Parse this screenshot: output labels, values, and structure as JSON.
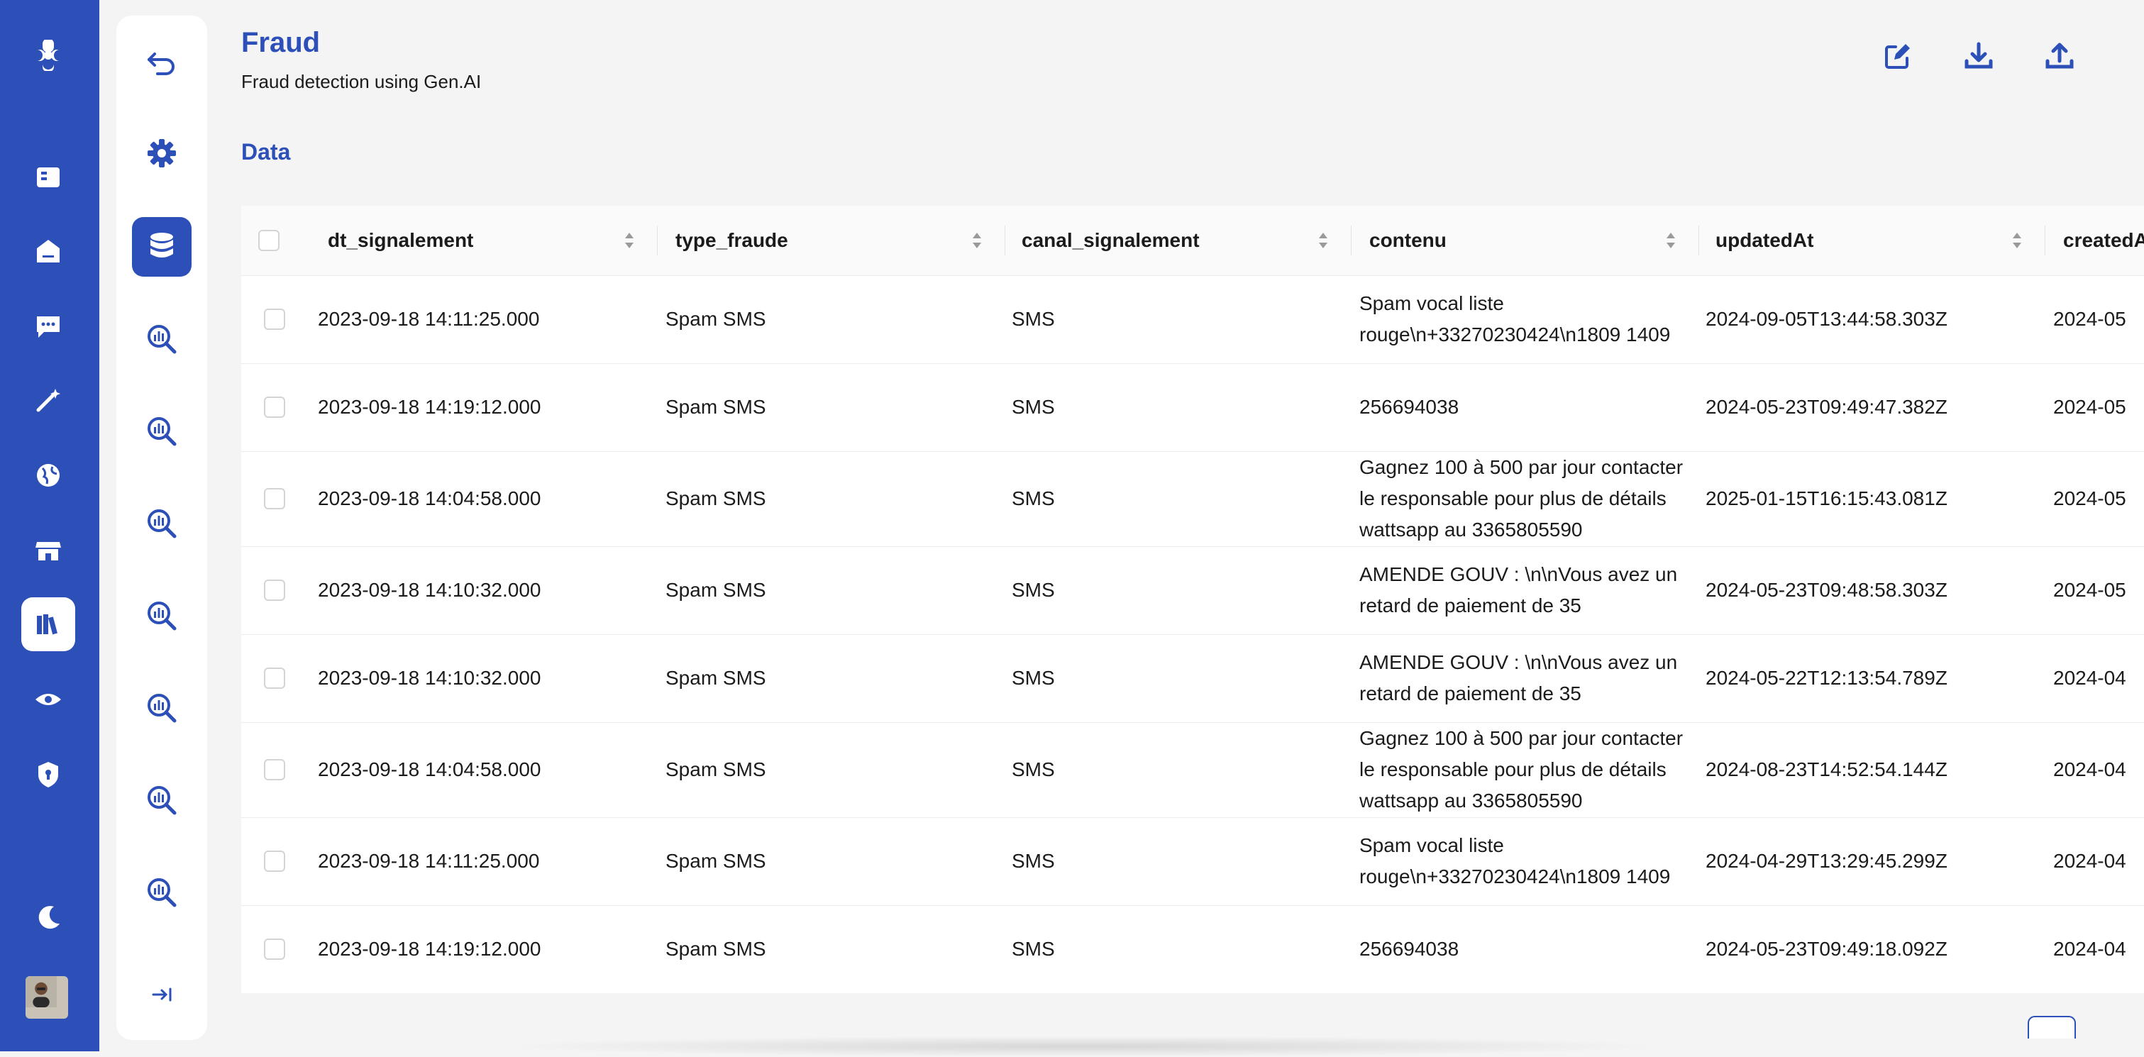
{
  "header": {
    "title": "Fraud",
    "subtitle": "Fraud detection using Gen.AI",
    "section_title": "Data"
  },
  "rail_icons": [
    "logo-icon",
    "dashboard-icon",
    "home-icon",
    "chat-icon",
    "magic-wand-icon",
    "globe-icon",
    "store-icon",
    "library-icon",
    "eye-icon",
    "shield-icon",
    "moon-icon"
  ],
  "panel_icons": [
    "undo-icon",
    "gear-icon",
    "database-icon",
    "analytics-search-icon",
    "analytics-search-icon",
    "analytics-search-icon",
    "analytics-search-icon",
    "analytics-search-icon",
    "analytics-search-icon",
    "analytics-search-icon",
    "expand-icon"
  ],
  "actions": [
    "edit-icon",
    "download-icon",
    "upload-icon"
  ],
  "table": {
    "columns": [
      "dt_signalement",
      "type_fraude",
      "canal_signalement",
      "contenu",
      "updatedAt",
      "createdAt"
    ],
    "rows": [
      [
        "2023-09-18 14:11:25.000",
        "Spam SMS",
        "SMS",
        "Spam vocal liste rouge\\n+33270230424\\n1809 1409",
        "2024-09-05T13:44:58.303Z",
        "2024-05"
      ],
      [
        "2023-09-18 14:19:12.000",
        "Spam SMS",
        "SMS",
        "256694038",
        "2024-05-23T09:49:47.382Z",
        "2024-05"
      ],
      [
        "2023-09-18 14:04:58.000",
        "Spam SMS",
        "SMS",
        "Gagnez 100 à 500 par jour contacter le responsable pour plus de détails wattsapp au 3365805590",
        "2025-01-15T16:15:43.081Z",
        "2024-05"
      ],
      [
        "2023-09-18 14:10:32.000",
        "Spam SMS",
        "SMS",
        "AMENDE GOUV : \\n\\nVous avez un retard de paiement de 35",
        "2024-05-23T09:48:58.303Z",
        "2024-05"
      ],
      [
        "2023-09-18 14:10:32.000",
        "Spam SMS",
        "SMS",
        "AMENDE GOUV : \\n\\nVous avez un retard de paiement de 35",
        "2024-05-22T12:13:54.789Z",
        "2024-04"
      ],
      [
        "2023-09-18 14:04:58.000",
        "Spam SMS",
        "SMS",
        "Gagnez 100 à 500 par jour contacter le responsable pour plus de détails wattsapp au 3365805590",
        "2024-08-23T14:52:54.144Z",
        "2024-04"
      ],
      [
        "2023-09-18 14:11:25.000",
        "Spam SMS",
        "SMS",
        "Spam vocal liste rouge\\n+33270230424\\n1809 1409",
        "2024-04-29T13:29:45.299Z",
        "2024-04"
      ],
      [
        "2023-09-18 14:19:12.000",
        "Spam SMS",
        "SMS",
        "256694038",
        "2024-05-23T09:49:18.092Z",
        "2024-04"
      ]
    ]
  },
  "colors": {
    "brand": "#2c4fb8",
    "background": "#f4f4f4"
  }
}
